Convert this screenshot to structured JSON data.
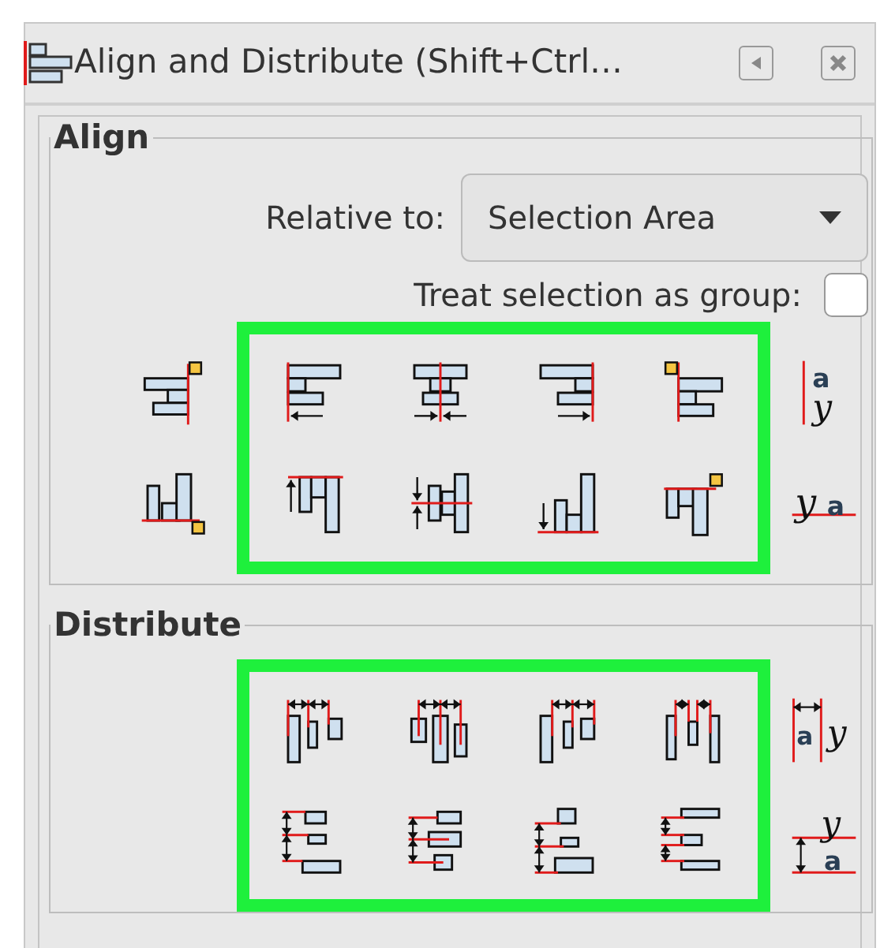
{
  "title": "Align and Distribute (Shift+Ctrl…",
  "align": {
    "label": "Align",
    "relative_label": "Relative to:",
    "relative_value": "Selection Area",
    "group_label": "Treat selection as group:",
    "group_checked": false,
    "rows": [
      {
        "anchor": {
          "kind": "anchor-right"
        },
        "buttons": [
          {
            "kind": "left"
          },
          {
            "kind": "center-x"
          },
          {
            "kind": "right"
          },
          {
            "kind": "anchor-left"
          }
        ],
        "text_button": {
          "kind": "baseline-vertical",
          "letters": [
            "a",
            "y"
          ]
        }
      },
      {
        "anchor": {
          "kind": "anchor-bottom"
        },
        "buttons": [
          {
            "kind": "top"
          },
          {
            "kind": "center-y"
          },
          {
            "kind": "bottom"
          },
          {
            "kind": "anchor-top"
          }
        ],
        "text_button": {
          "kind": "baseline-horizontal",
          "letters": [
            "y",
            "a"
          ]
        }
      }
    ]
  },
  "distribute": {
    "label": "Distribute",
    "rows": [
      {
        "buttons": [
          {
            "kind": "left-edges"
          },
          {
            "kind": "centers-x"
          },
          {
            "kind": "right-edges"
          },
          {
            "kind": "gaps-x"
          }
        ],
        "text_button": {
          "kind": "text-spacing-x",
          "letters": [
            "a",
            "y"
          ]
        }
      },
      {
        "buttons": [
          {
            "kind": "top-edges"
          },
          {
            "kind": "centers-y"
          },
          {
            "kind": "bottom-edges"
          },
          {
            "kind": "gaps-y"
          }
        ],
        "text_button": {
          "kind": "text-spacing-y",
          "letters": [
            "y",
            "a"
          ]
        }
      }
    ]
  }
}
